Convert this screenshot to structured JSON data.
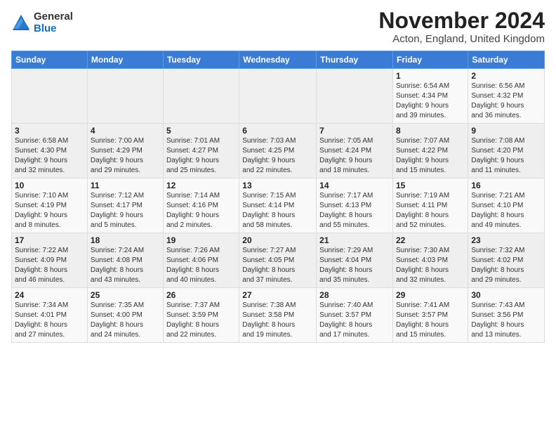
{
  "logo": {
    "general": "General",
    "blue": "Blue"
  },
  "title": "November 2024",
  "location": "Acton, England, United Kingdom",
  "days_header": [
    "Sunday",
    "Monday",
    "Tuesday",
    "Wednesday",
    "Thursday",
    "Friday",
    "Saturday"
  ],
  "weeks": [
    [
      {
        "day": "",
        "info": ""
      },
      {
        "day": "",
        "info": ""
      },
      {
        "day": "",
        "info": ""
      },
      {
        "day": "",
        "info": ""
      },
      {
        "day": "",
        "info": ""
      },
      {
        "day": "1",
        "info": "Sunrise: 6:54 AM\nSunset: 4:34 PM\nDaylight: 9 hours\nand 39 minutes."
      },
      {
        "day": "2",
        "info": "Sunrise: 6:56 AM\nSunset: 4:32 PM\nDaylight: 9 hours\nand 36 minutes."
      }
    ],
    [
      {
        "day": "3",
        "info": "Sunrise: 6:58 AM\nSunset: 4:30 PM\nDaylight: 9 hours\nand 32 minutes."
      },
      {
        "day": "4",
        "info": "Sunrise: 7:00 AM\nSunset: 4:29 PM\nDaylight: 9 hours\nand 29 minutes."
      },
      {
        "day": "5",
        "info": "Sunrise: 7:01 AM\nSunset: 4:27 PM\nDaylight: 9 hours\nand 25 minutes."
      },
      {
        "day": "6",
        "info": "Sunrise: 7:03 AM\nSunset: 4:25 PM\nDaylight: 9 hours\nand 22 minutes."
      },
      {
        "day": "7",
        "info": "Sunrise: 7:05 AM\nSunset: 4:24 PM\nDaylight: 9 hours\nand 18 minutes."
      },
      {
        "day": "8",
        "info": "Sunrise: 7:07 AM\nSunset: 4:22 PM\nDaylight: 9 hours\nand 15 minutes."
      },
      {
        "day": "9",
        "info": "Sunrise: 7:08 AM\nSunset: 4:20 PM\nDaylight: 9 hours\nand 11 minutes."
      }
    ],
    [
      {
        "day": "10",
        "info": "Sunrise: 7:10 AM\nSunset: 4:19 PM\nDaylight: 9 hours\nand 8 minutes."
      },
      {
        "day": "11",
        "info": "Sunrise: 7:12 AM\nSunset: 4:17 PM\nDaylight: 9 hours\nand 5 minutes."
      },
      {
        "day": "12",
        "info": "Sunrise: 7:14 AM\nSunset: 4:16 PM\nDaylight: 9 hours\nand 2 minutes."
      },
      {
        "day": "13",
        "info": "Sunrise: 7:15 AM\nSunset: 4:14 PM\nDaylight: 8 hours\nand 58 minutes."
      },
      {
        "day": "14",
        "info": "Sunrise: 7:17 AM\nSunset: 4:13 PM\nDaylight: 8 hours\nand 55 minutes."
      },
      {
        "day": "15",
        "info": "Sunrise: 7:19 AM\nSunset: 4:11 PM\nDaylight: 8 hours\nand 52 minutes."
      },
      {
        "day": "16",
        "info": "Sunrise: 7:21 AM\nSunset: 4:10 PM\nDaylight: 8 hours\nand 49 minutes."
      }
    ],
    [
      {
        "day": "17",
        "info": "Sunrise: 7:22 AM\nSunset: 4:09 PM\nDaylight: 8 hours\nand 46 minutes."
      },
      {
        "day": "18",
        "info": "Sunrise: 7:24 AM\nSunset: 4:08 PM\nDaylight: 8 hours\nand 43 minutes."
      },
      {
        "day": "19",
        "info": "Sunrise: 7:26 AM\nSunset: 4:06 PM\nDaylight: 8 hours\nand 40 minutes."
      },
      {
        "day": "20",
        "info": "Sunrise: 7:27 AM\nSunset: 4:05 PM\nDaylight: 8 hours\nand 37 minutes."
      },
      {
        "day": "21",
        "info": "Sunrise: 7:29 AM\nSunset: 4:04 PM\nDaylight: 8 hours\nand 35 minutes."
      },
      {
        "day": "22",
        "info": "Sunrise: 7:30 AM\nSunset: 4:03 PM\nDaylight: 8 hours\nand 32 minutes."
      },
      {
        "day": "23",
        "info": "Sunrise: 7:32 AM\nSunset: 4:02 PM\nDaylight: 8 hours\nand 29 minutes."
      }
    ],
    [
      {
        "day": "24",
        "info": "Sunrise: 7:34 AM\nSunset: 4:01 PM\nDaylight: 8 hours\nand 27 minutes."
      },
      {
        "day": "25",
        "info": "Sunrise: 7:35 AM\nSunset: 4:00 PM\nDaylight: 8 hours\nand 24 minutes."
      },
      {
        "day": "26",
        "info": "Sunrise: 7:37 AM\nSunset: 3:59 PM\nDaylight: 8 hours\nand 22 minutes."
      },
      {
        "day": "27",
        "info": "Sunrise: 7:38 AM\nSunset: 3:58 PM\nDaylight: 8 hours\nand 19 minutes."
      },
      {
        "day": "28",
        "info": "Sunrise: 7:40 AM\nSunset: 3:57 PM\nDaylight: 8 hours\nand 17 minutes."
      },
      {
        "day": "29",
        "info": "Sunrise: 7:41 AM\nSunset: 3:57 PM\nDaylight: 8 hours\nand 15 minutes."
      },
      {
        "day": "30",
        "info": "Sunrise: 7:43 AM\nSunset: 3:56 PM\nDaylight: 8 hours\nand 13 minutes."
      }
    ]
  ]
}
